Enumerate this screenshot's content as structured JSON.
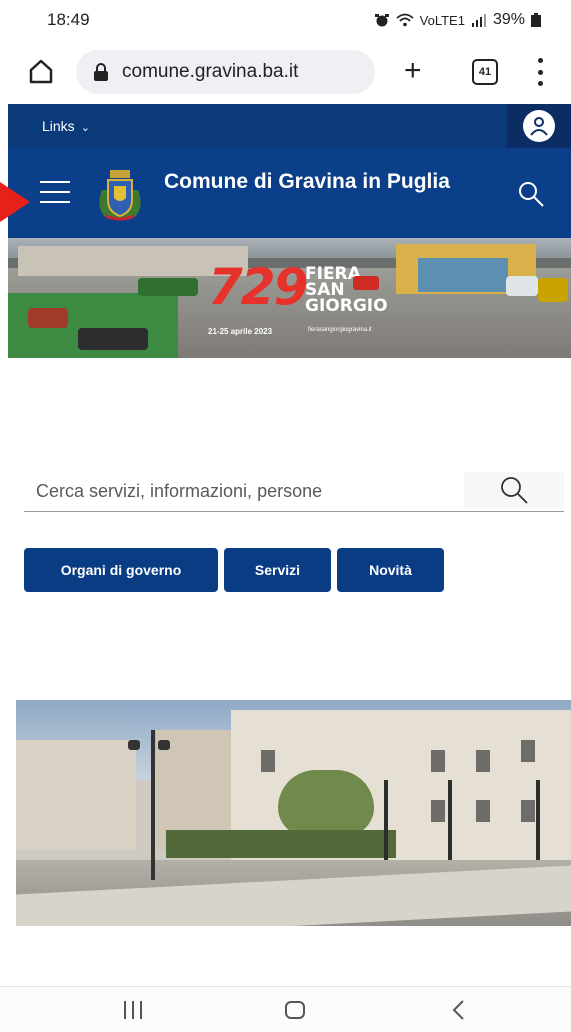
{
  "status_bar": {
    "time": "18:49",
    "network": "VoLTE1",
    "battery": "39%"
  },
  "browser": {
    "url": "comune.gravina.ba.it",
    "tab_count": "41",
    "new_tab_label": "+"
  },
  "site": {
    "links_label": "Links",
    "title": "Comune di Gravina in Puglia",
    "accent_color": "#0b3f8a"
  },
  "banner": {
    "number": "729",
    "event_line1": "FIERA",
    "event_line2": "SAN",
    "event_line3": "GIORGIO",
    "dates": "21-25 aprile 2023",
    "website": "fierasangiorgiogravina.it"
  },
  "search": {
    "placeholder": "Cerca servizi, informazioni, persone"
  },
  "quick_links": [
    {
      "label": "Organi di governo"
    },
    {
      "label": "Servizi"
    },
    {
      "label": "Novità"
    }
  ],
  "icons": {
    "home": "home-icon",
    "lock": "lock-icon",
    "menu": "more-vertical-icon",
    "user": "user-icon",
    "hamburger": "hamburger-menu-icon",
    "search": "search-icon",
    "emblem": "town-emblem-icon"
  }
}
